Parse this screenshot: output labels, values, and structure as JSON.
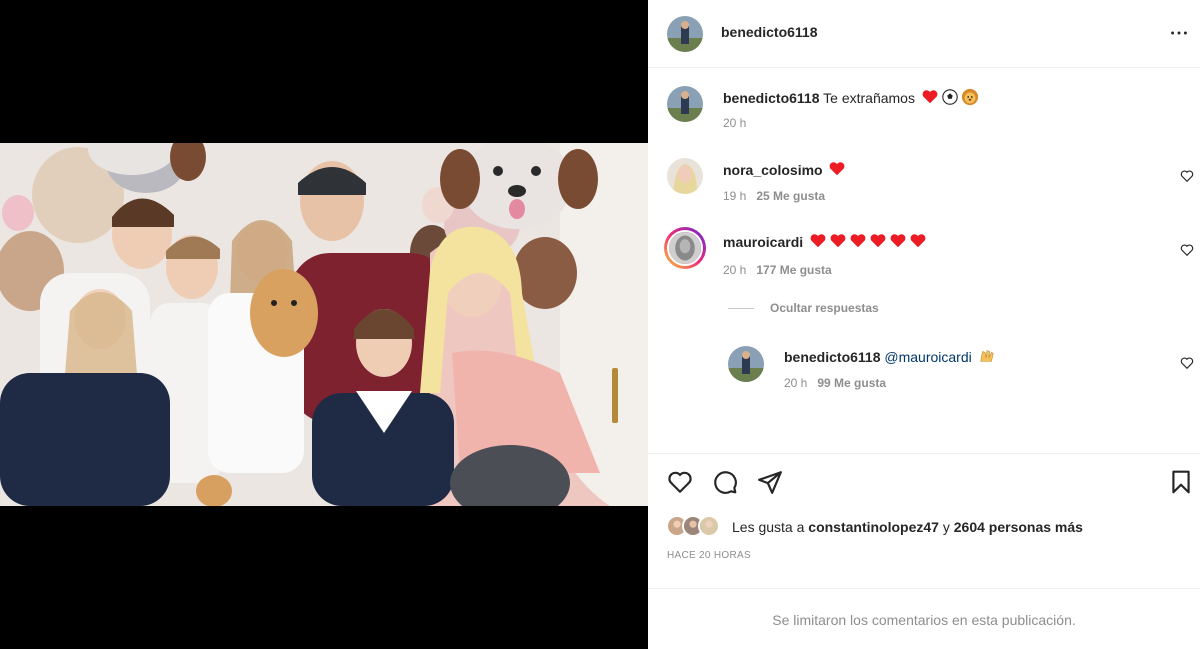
{
  "post": {
    "author": "benedicto6118",
    "more_icon": "more-horizontal-icon"
  },
  "caption": {
    "username": "benedicto6118",
    "text": "Te extrañamos",
    "emojis": [
      "red-heart",
      "soccer-ball",
      "lion-face"
    ],
    "time": "20 h"
  },
  "comments": [
    {
      "username": "nora_colosimo",
      "text": "",
      "emojis": [
        "red-heart"
      ],
      "time": "19 h",
      "likes": "25 Me gusta"
    },
    {
      "username": "mauroicardi",
      "text": "",
      "emojis": [
        "red-heart",
        "red-heart",
        "red-heart",
        "red-heart",
        "red-heart",
        "red-heart"
      ],
      "time": "20 h",
      "likes": "177 Me gusta",
      "has_story_ring": true
    }
  ],
  "replies_toggle": "Ocultar respuestas",
  "reply": {
    "username": "benedicto6118",
    "mention": "@mauroicardi",
    "emojis": [
      "raising-hands"
    ],
    "time": "20 h",
    "likes": "99 Me gusta"
  },
  "actions": {
    "like_icon": "heart-icon",
    "comment_icon": "comment-icon",
    "share_icon": "send-icon",
    "save_icon": "bookmark-icon"
  },
  "likes_summary": {
    "prefix": "Les gusta a",
    "user": "constantinolopez47",
    "connector": "y",
    "others": "2604 personas más"
  },
  "timestamp": "HACE 20 HORAS",
  "comments_limited": "Se limitaron los comentarios en esta publicación.",
  "colors": {
    "text": "#262626",
    "secondary": "#8e8e8e",
    "border": "#efefef",
    "heart_red": "#ed1c24"
  }
}
